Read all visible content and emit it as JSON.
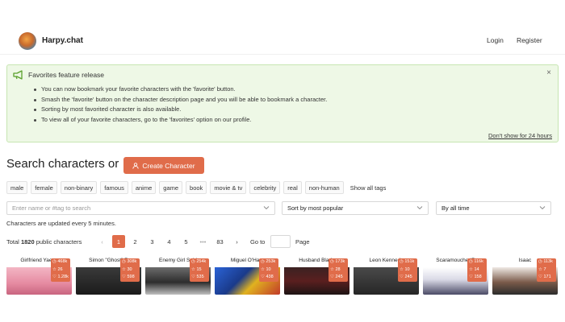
{
  "header": {
    "brand": "Harpy.chat",
    "login": "Login",
    "register": "Register"
  },
  "banner": {
    "title": "Favorites feature release",
    "close": "×",
    "items": [
      "You can now bookmark your favorite characters with the 'favorite' button.",
      "Smash the 'favorite' button on the character description page and you will be able to bookmark a character.",
      "Sorting by most favorited character is also available.",
      "To view all of your favorite characters, go to the 'favorites' option on our profile."
    ],
    "dismiss": "Don't show for 24 hours",
    "accent": "#5aa02c"
  },
  "search": {
    "title": "Search characters or",
    "create_label": "Create Character",
    "name_placeholder": "Enter name or #tag to search",
    "sort_value": "Sort by most popular",
    "time_value": "By all time",
    "update_note": "Characters are updated every 5 minutes."
  },
  "tags": [
    "male",
    "female",
    "non-binary",
    "famous",
    "anime",
    "game",
    "book",
    "movie & tv",
    "celebrity",
    "real",
    "non-human"
  ],
  "show_all_tags": "Show all tags",
  "pagination": {
    "total_prefix": "Total",
    "total_count": "1820",
    "total_suffix": "public characters",
    "prev": "‹",
    "pages": [
      "1",
      "2",
      "3",
      "4",
      "5"
    ],
    "ellipsis": "•••",
    "last": "83",
    "next": "›",
    "goto_label": "Go to",
    "page_label": "Page",
    "current_page": 1
  },
  "characters": [
    {
      "name": "Girlfriend Yae m",
      "views": "468k",
      "favorites": "26",
      "likes": "1.28k"
    },
    {
      "name": "Simon \"Ghost\" R",
      "views": "308k",
      "favorites": "30",
      "likes": "598"
    },
    {
      "name": "Enemy Girl Sold",
      "views": "254k",
      "favorites": "15",
      "likes": "535"
    },
    {
      "name": "Miguel O'Hara",
      "views": "253k",
      "favorites": "10",
      "likes": "438"
    },
    {
      "name": "Husband Blade",
      "views": "173k",
      "favorites": "28",
      "likes": "245"
    },
    {
      "name": "Leon Kennedy",
      "views": "151k",
      "favorites": "10",
      "likes": "245"
    },
    {
      "name": "Scaramouche (B",
      "views": "116k",
      "favorites": "14",
      "likes": "158"
    },
    {
      "name": "Isaac",
      "views": "113k",
      "favorites": "7",
      "likes": "171"
    }
  ],
  "colors": {
    "accent": "#e06c4a",
    "banner_bg": "#eef8e6"
  }
}
